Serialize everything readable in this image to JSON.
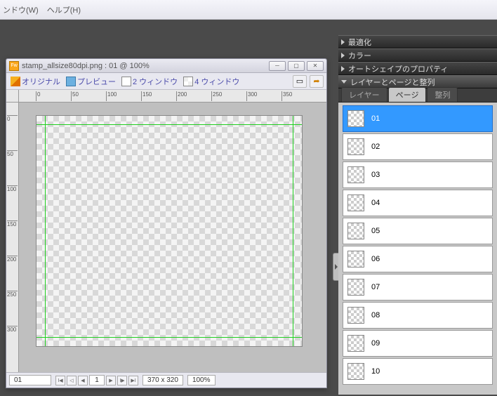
{
  "menu": {
    "window": "ンドウ(W)",
    "help": "ヘルプ(H)"
  },
  "doc": {
    "title": "stamp_allsize80dpi.png : 01 @ 100%",
    "toolbar": {
      "original": "オリジナル",
      "preview": "プレビュー",
      "two_window": "2 ウィンドウ",
      "four_window": "4 ウィンドウ"
    },
    "ruler_h": [
      "0",
      "50",
      "100",
      "150",
      "200",
      "250",
      "300",
      "350"
    ],
    "ruler_v": [
      "0",
      "50",
      "100",
      "150",
      "200",
      "250",
      "300"
    ],
    "status": {
      "page": "01",
      "page_num": "1",
      "dimensions": "370 x 320",
      "zoom": "100%"
    }
  },
  "panels": {
    "optimize": "最適化",
    "color": "カラー",
    "autoshape": "オートシェイプのプロパティ",
    "layers_pages": "レイヤーとページと整列",
    "tabs": {
      "layer": "レイヤー",
      "page": "ページ",
      "align": "整列"
    },
    "pages": [
      {
        "label": "01",
        "selected": true
      },
      {
        "label": "02",
        "selected": false
      },
      {
        "label": "03",
        "selected": false
      },
      {
        "label": "04",
        "selected": false
      },
      {
        "label": "05",
        "selected": false
      },
      {
        "label": "06",
        "selected": false
      },
      {
        "label": "07",
        "selected": false
      },
      {
        "label": "08",
        "selected": false
      },
      {
        "label": "09",
        "selected": false
      },
      {
        "label": "10",
        "selected": false
      }
    ]
  }
}
